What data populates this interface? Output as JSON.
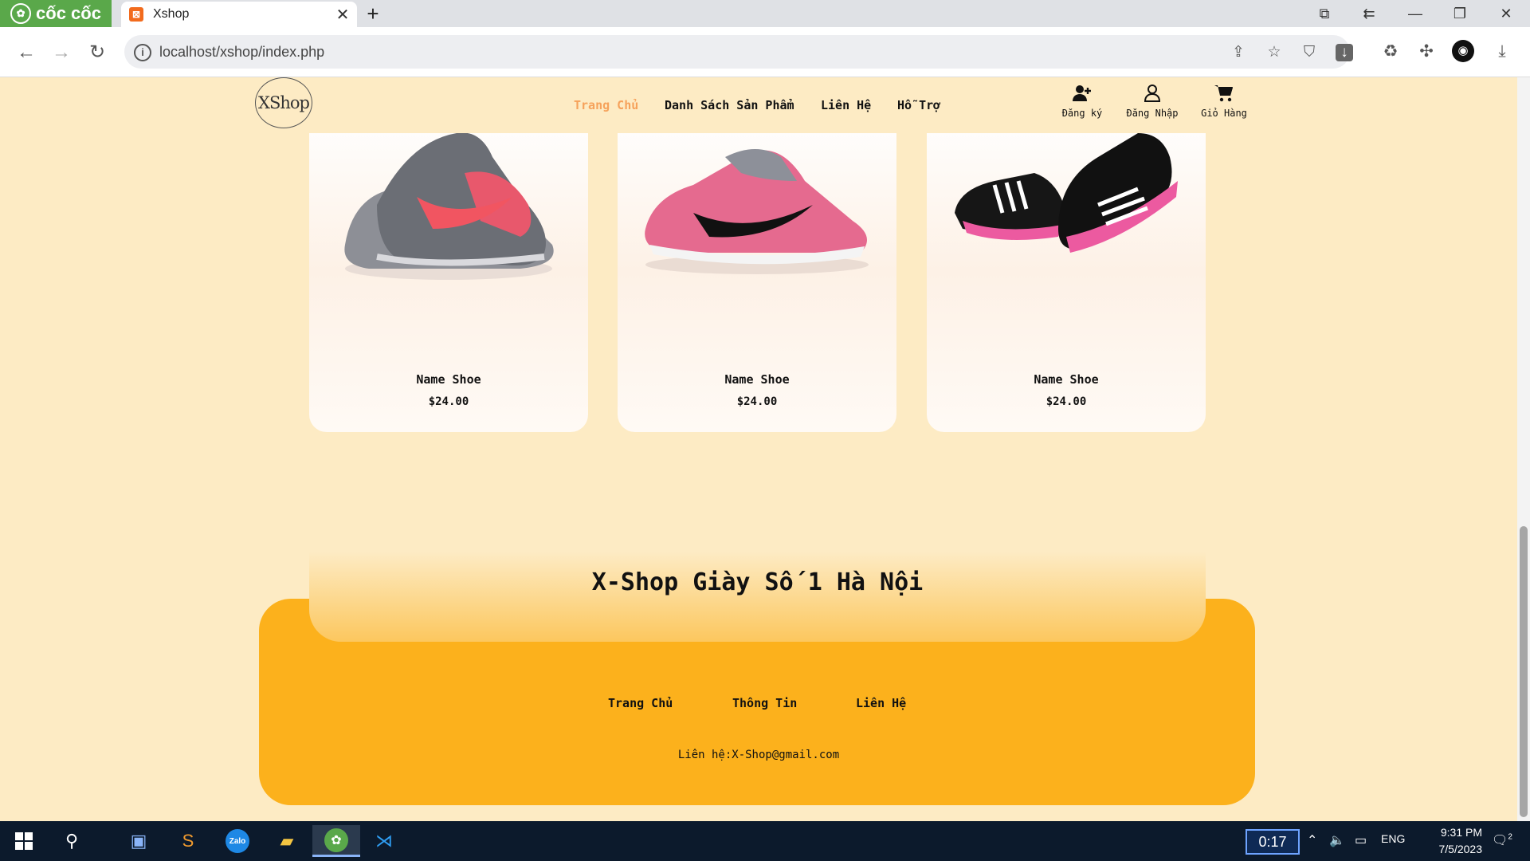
{
  "browser": {
    "brand": "cốc cốc",
    "tab_title": "Xshop",
    "url": "localhost/xshop/index.php"
  },
  "site": {
    "logo": "XShop",
    "nav": [
      "Trang Chủ",
      "Danh Sách Sản Phẩm",
      "Liên Hệ",
      "Hỗ Trợ"
    ],
    "user_actions": [
      {
        "label": "Đăng ký",
        "icon": "user-plus-icon"
      },
      {
        "label": "Đăng Nhập",
        "icon": "user-icon"
      },
      {
        "label": "Giỏ Hàng",
        "icon": "cart-icon"
      }
    ],
    "products": [
      {
        "name": "Name Shoe",
        "price": "$24.00"
      },
      {
        "name": "Name Shoe",
        "price": "$24.00"
      },
      {
        "name": "Name Shoe",
        "price": "$24.00"
      }
    ],
    "tagline": "X-Shop Giày Số 1 Hà Nội",
    "footer_links": [
      "Trang Chủ",
      "Thông Tin",
      "Liên Hệ"
    ],
    "contact": "Liên hệ:X-Shop@gmail.com"
  },
  "taskbar": {
    "timer": "0:17",
    "lang": "ENG",
    "time": "9:31 PM",
    "date": "7/5/2023",
    "notifications": "2"
  },
  "colors": {
    "page_bg": "#fdebc4",
    "footer": "#fcb11c",
    "nav_active": "#f6a25b"
  }
}
